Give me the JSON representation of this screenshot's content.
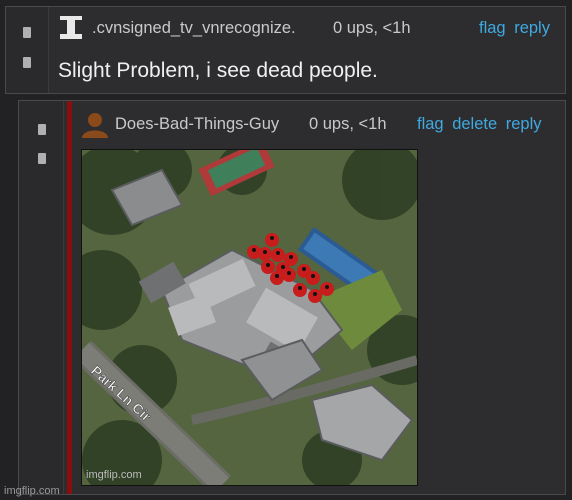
{
  "comments": [
    {
      "username": ".cvnsigned_tv_vnrecognize.",
      "meta": "0 ups, <1h",
      "actions": [
        "flag",
        "reply"
      ],
      "text": "Slight Problem, i see dead people."
    },
    {
      "username": "Does-Bad-Things-Guy",
      "meta": "0 ups, <1h",
      "actions": [
        "flag",
        "delete",
        "reply"
      ],
      "image": {
        "street_label": "Park Ln Cir",
        "image_watermark": "imgflip.com"
      }
    }
  ],
  "site_watermark": "imgflip.com",
  "colors": {
    "link": "#3fa9e0",
    "thread_bar": "#8a0e0e",
    "background": "#222224",
    "panel": "#2d2d30"
  },
  "icons": [
    "user-avatar-icon",
    "upvote-icon",
    "downvote-icon",
    "person-marker-icon"
  ]
}
